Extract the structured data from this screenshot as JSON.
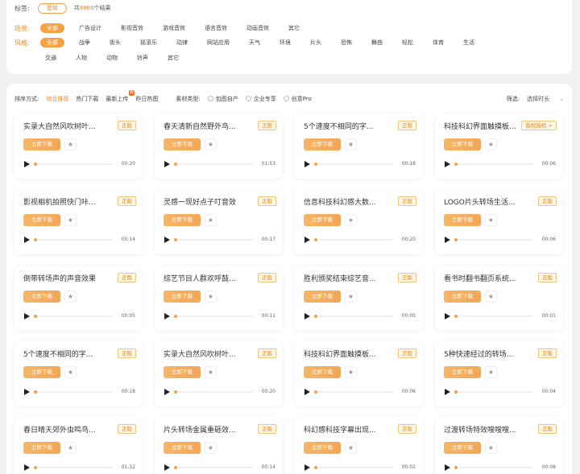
{
  "tags": {
    "label": "标签:",
    "tag": "音效",
    "result_prefix": "共",
    "result_count": "8888",
    "result_suffix": "个结果"
  },
  "scene": {
    "label": "场景:",
    "items": [
      "全部",
      "广告设计",
      "影视音效",
      "游戏音效",
      "语言音效",
      "动画音效",
      "其它"
    ]
  },
  "style": {
    "label": "风格:",
    "items_row1": [
      "全部",
      "战争",
      "街头",
      "摇滚乐",
      "动律",
      "网站应用",
      "天气",
      "环境",
      "片头",
      "恐怖",
      "舞曲",
      "轻松",
      "体育",
      "生活"
    ],
    "items_row2": [
      "交通",
      "人物",
      "动物",
      "铃声",
      "其它"
    ]
  },
  "sort": {
    "label": "排序方式:",
    "options": [
      "综合推荐",
      "热门下载",
      "最新上传",
      "昨日热图"
    ],
    "new_badge": "新",
    "material_label": "素材类型:",
    "material_options": [
      "包图自产",
      "企业专享",
      "创意Pro"
    ],
    "filter_label": "筛选:",
    "filter_value": "选择时长",
    "filter_chevron": "⌄"
  },
  "card_labels": {
    "download": "立即下载",
    "fav_icon": "★"
  },
  "cards": [
    {
      "title": "实录大自然风吹树叶...",
      "badge": "正版",
      "duration": "00:20"
    },
    {
      "title": "春天清新自然野外鸟...",
      "badge": "正版",
      "duration": "01:53"
    },
    {
      "title": "5个速度不相同的字...",
      "badge": "正版",
      "duration": "00:18"
    },
    {
      "title": "科技科幻界面触摸板...",
      "badge": "版权授权 >",
      "duration": "00:06"
    },
    {
      "title": "影视相机拍照快门咔...",
      "badge": "正版",
      "duration": "00:14"
    },
    {
      "title": "灵感一现好点子叮音效",
      "badge": "正版",
      "duration": "00:17"
    },
    {
      "title": "信息科技科幻感大数...",
      "badge": "正版",
      "duration": "00:20"
    },
    {
      "title": "LOGO片头转场生活...",
      "badge": "正版",
      "duration": "00:06"
    },
    {
      "title": "倒带转场声的声音效果",
      "badge": "正版",
      "duration": "00:05"
    },
    {
      "title": "综艺节目人群欢呼鼓...",
      "badge": "正版",
      "duration": "00:11"
    },
    {
      "title": "胜利颁奖结束综艺音...",
      "badge": "正版",
      "duration": "00:05"
    },
    {
      "title": "看书时翻书翻页系统...",
      "badge": "正版",
      "duration": "00:01"
    },
    {
      "title": "5个速度不相同的字...",
      "badge": "正版",
      "duration": "00:18"
    },
    {
      "title": "实录大自然风吹树叶...",
      "badge": "正版",
      "duration": "00:20"
    },
    {
      "title": "科技科幻界面触摸板...",
      "badge": "正版",
      "duration": "00:06"
    },
    {
      "title": "5种快速经过的转场...",
      "badge": "正版",
      "duration": "00:04"
    },
    {
      "title": "春日晴天郊外虫鸣鸟...",
      "badge": "正版",
      "duration": "01:12"
    },
    {
      "title": "片头转场金属重砸效...",
      "badge": "正版",
      "duration": "00:14"
    },
    {
      "title": "科幻感科技字幕出现...",
      "badge": "正版",
      "duration": "00:02"
    },
    {
      "title": "过渡转场特效嗖嗖嗖...",
      "badge": "正版",
      "duration": "00:08"
    }
  ],
  "colors": {
    "accent": "#f5a245",
    "accent_text": "#f08a24",
    "background": "#f1f1f4"
  }
}
